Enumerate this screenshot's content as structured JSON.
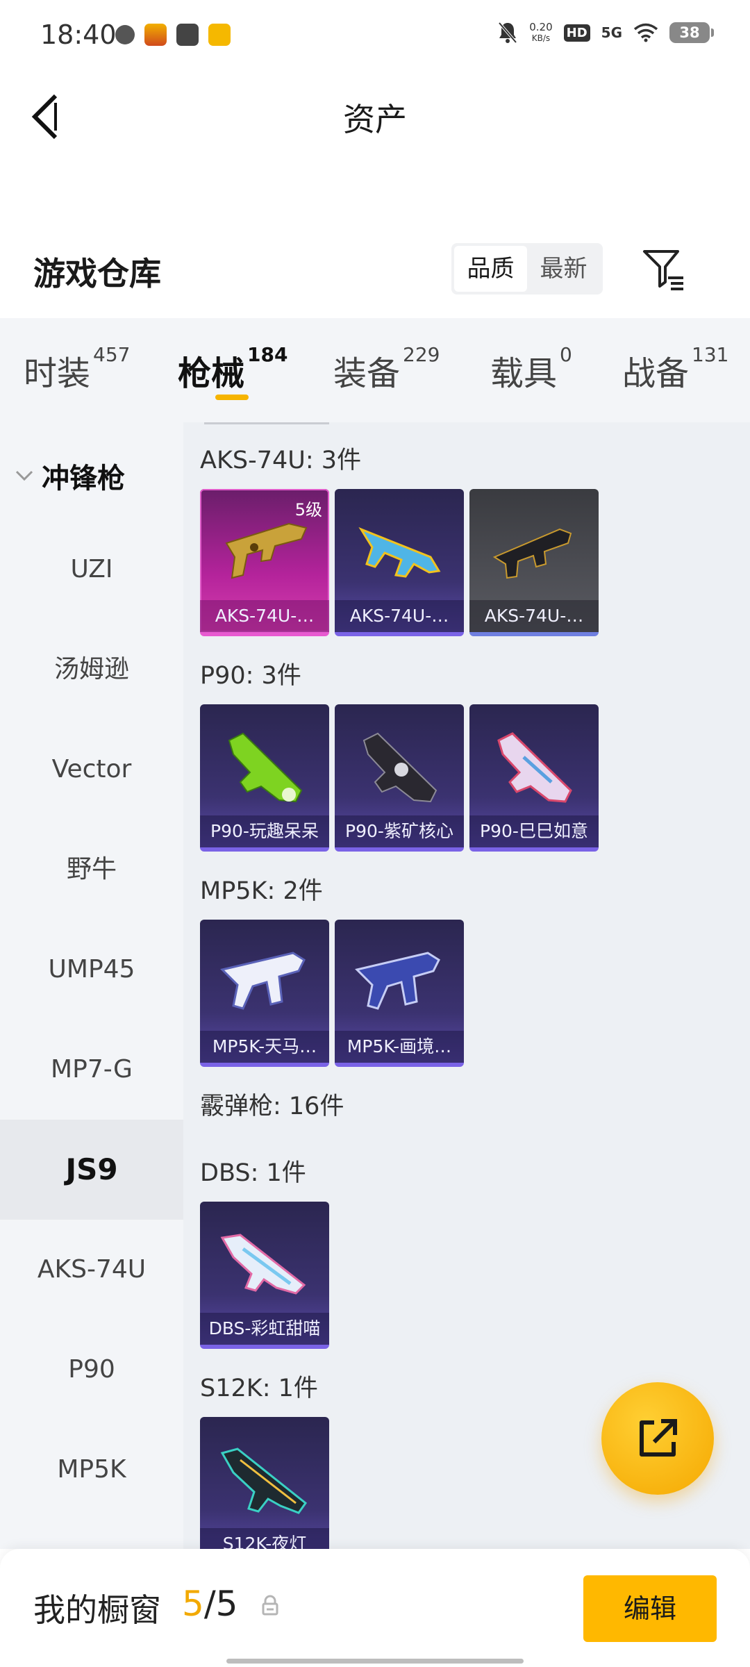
{
  "status_bar": {
    "time": "18:40",
    "net_speed_value": "0.20",
    "net_speed_unit": "KB/s",
    "hd": "HD",
    "signal": "5G",
    "battery": "38"
  },
  "header": {
    "title": "资产"
  },
  "section": {
    "title": "游戏仓库",
    "sort_options": [
      "品质",
      "最新"
    ],
    "active_sort": "品质"
  },
  "tabs": [
    {
      "label": "时装",
      "count": "457"
    },
    {
      "label": "枪械",
      "count": "184"
    },
    {
      "label": "装备",
      "count": "229"
    },
    {
      "label": "载具",
      "count": "0"
    },
    {
      "label": "战备",
      "count": "131"
    }
  ],
  "active_tab": "枪械",
  "sidebar": {
    "category": "冲锋枪",
    "items": [
      "UZI",
      "汤姆逊",
      "Vector",
      "野牛",
      "UMP45",
      "MP7-G",
      "JS9",
      "AKS-74U",
      "P90",
      "MP5K"
    ],
    "active_item": "JS9"
  },
  "groups": [
    {
      "title": "AKS-74U: 3件",
      "items": [
        {
          "name": "AKS-74U-…",
          "level": "5级",
          "rarity": "gold"
        },
        {
          "name": "AKS-74U-…",
          "rarity": "purple"
        },
        {
          "name": "AKS-74U-…",
          "rarity": "gray"
        }
      ]
    },
    {
      "title": "P90: 3件",
      "items": [
        {
          "name": "P90-玩趣呆呆",
          "rarity": "purple"
        },
        {
          "name": "P90-紫矿核心",
          "rarity": "purple"
        },
        {
          "name": "P90-巳巳如意",
          "rarity": "purple"
        }
      ]
    },
    {
      "title": "MP5K: 2件",
      "items": [
        {
          "name": "MP5K-天马…",
          "rarity": "purple"
        },
        {
          "name": "MP5K-画境…",
          "rarity": "purple"
        }
      ]
    },
    {
      "title": "霰弹枪: 16件",
      "items": []
    },
    {
      "title": "DBS: 1件",
      "items": [
        {
          "name": "DBS-彩虹甜喵",
          "rarity": "purple"
        }
      ]
    },
    {
      "title": "S12K: 1件",
      "items": [
        {
          "name": "S12K-夜灯",
          "rarity": "purple"
        }
      ]
    }
  ],
  "bottom_bar": {
    "label": "我的橱窗",
    "current": "5",
    "total": "/5",
    "edit_label": "编辑"
  },
  "icons": {
    "back": "back-arrow-icon",
    "filter": "filter-icon",
    "share": "share-icon",
    "lock": "lock-icon"
  },
  "colors": {
    "accent": "#f6b400",
    "gold_card": "#c42aa8",
    "purple_card": "#3b3270"
  }
}
